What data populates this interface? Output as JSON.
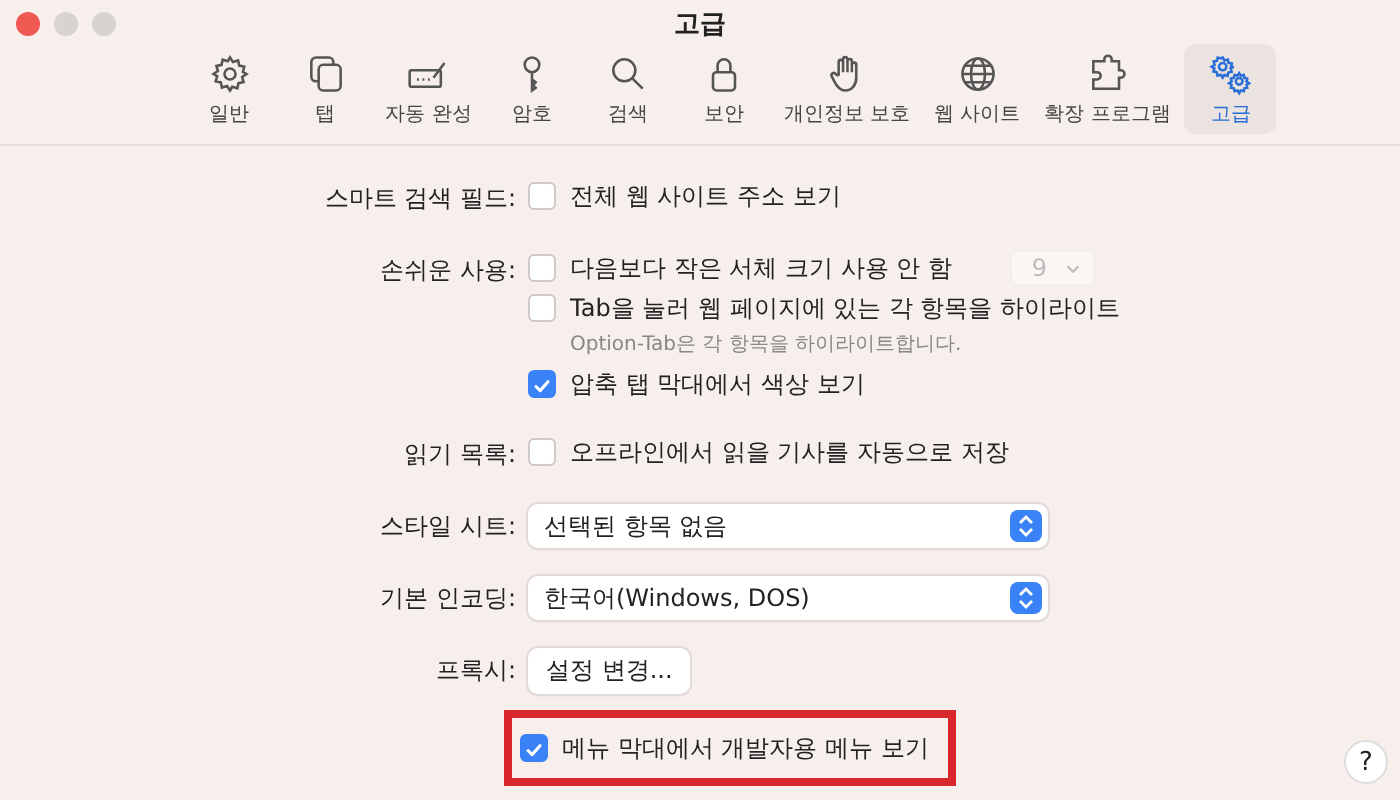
{
  "window": {
    "title": "고급"
  },
  "toolbar": {
    "tabs": [
      {
        "label": "일반",
        "selected": false
      },
      {
        "label": "탭",
        "selected": false
      },
      {
        "label": "자동 완성",
        "selected": false
      },
      {
        "label": "암호",
        "selected": false
      },
      {
        "label": "검색",
        "selected": false
      },
      {
        "label": "보안",
        "selected": false
      },
      {
        "label": "개인정보 보호",
        "selected": false
      },
      {
        "label": "웹 사이트",
        "selected": false
      },
      {
        "label": "확장 프로그램",
        "selected": false
      },
      {
        "label": "고급",
        "selected": true
      }
    ]
  },
  "settings": [
    {
      "label": "스마트 검색 필드:",
      "items": [
        {
          "kind": "checkbox",
          "text": "전체 웹 사이트 주소 보기",
          "checked": false
        }
      ]
    },
    {
      "label": "손쉬운 사용:",
      "items": [
        {
          "kind": "checkbox",
          "text": "다음보다 작은 서체 크기 사용 안 함",
          "checked": false,
          "size_popup": {
            "value": "9",
            "disabled": true
          }
        },
        {
          "kind": "checkbox",
          "text": "Tab을 눌러 웹 페이지에 있는 각 항목을 하이라이트",
          "checked": false
        },
        {
          "kind": "note",
          "text": "Option-Tab은 각 항목을 하이라이트합니다."
        },
        {
          "kind": "checkbox",
          "text": "압축 탭 막대에서 색상 보기",
          "checked": true
        }
      ]
    },
    {
      "label": "읽기 목록:",
      "items": [
        {
          "kind": "checkbox",
          "text": "오프라인에서 읽을 기사를 자동으로 저장",
          "checked": false
        }
      ]
    },
    {
      "label": "스타일 시트:",
      "items": [
        {
          "kind": "popup",
          "text": "선택된 항목 없음"
        }
      ]
    },
    {
      "label": "기본 인코딩:",
      "items": [
        {
          "kind": "popup",
          "text": "한국어(Windows, DOS)"
        }
      ]
    },
    {
      "label": "프록시:",
      "items": [
        {
          "kind": "button",
          "text": "설정 변경..."
        }
      ]
    },
    {
      "items": [
        {
          "kind": "checkbox",
          "text": "메뉴 막대에서 개발자용 메뉴 보기",
          "checked": true,
          "highlighted": true
        }
      ]
    }
  ],
  "help_button": {
    "label": "?"
  }
}
